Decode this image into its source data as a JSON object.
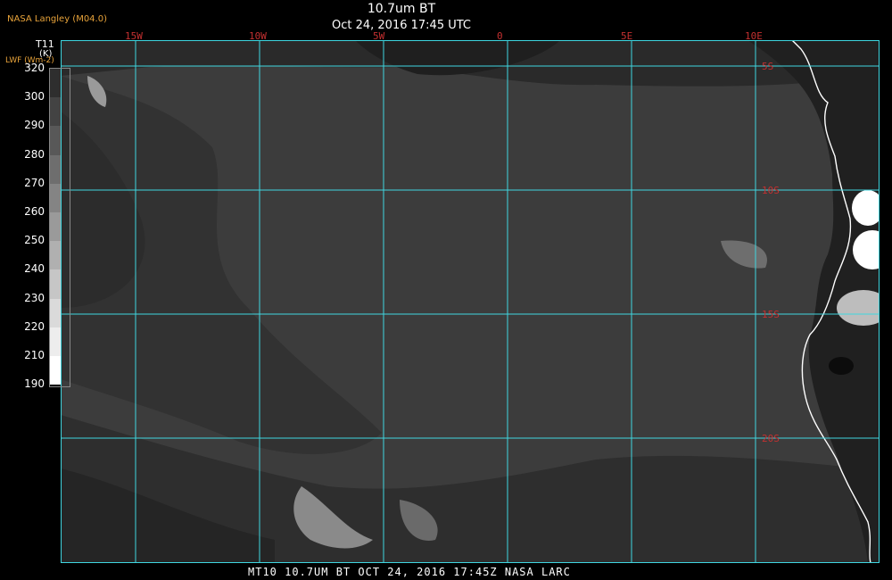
{
  "header": {
    "brand": "NASA Langley (M04.0)",
    "title": "10.7um BT",
    "subtitle": "Oct 24, 2016 17:45 UTC"
  },
  "colorbar": {
    "name": "T11",
    "unit": "(K)",
    "alt_label": "LWF (Wm-2)",
    "ticks": [
      "320",
      "300",
      "290",
      "280",
      "270",
      "260",
      "250",
      "240",
      "230",
      "220",
      "210",
      "190"
    ],
    "levels": [
      {
        "lo": 190,
        "hi": 210,
        "color": "#ffffff"
      },
      {
        "lo": 210,
        "hi": 220,
        "color": "#ededed"
      },
      {
        "lo": 220,
        "hi": 230,
        "color": "#dadada"
      },
      {
        "lo": 230,
        "hi": 240,
        "color": "#c6c6c6"
      },
      {
        "lo": 240,
        "hi": 250,
        "color": "#b0b0b0"
      },
      {
        "lo": 250,
        "hi": 260,
        "color": "#9a9a9a"
      },
      {
        "lo": 260,
        "hi": 270,
        "color": "#848484"
      },
      {
        "lo": 270,
        "hi": 280,
        "color": "#6e6e6e"
      },
      {
        "lo": 280,
        "hi": 290,
        "color": "#585858"
      },
      {
        "lo": 290,
        "hi": 300,
        "color": "#434343"
      },
      {
        "lo": 300,
        "hi": 320,
        "color": "#2e2e2e"
      }
    ]
  },
  "map": {
    "grid_color": "#3fd6e0",
    "label_lon_color": "#c43030",
    "label_lat_color": "#c43030",
    "coast_color": "#ffffff",
    "longitudes": [
      "15W",
      "10W",
      "5W",
      "0",
      "5E",
      "10E"
    ],
    "latitudes": [
      "5S",
      "10S",
      "15S",
      "20S"
    ]
  },
  "footer": {
    "text": "MT10  10.7UM BT   OCT 24, 2016 17:45Z   NASA LARC"
  }
}
